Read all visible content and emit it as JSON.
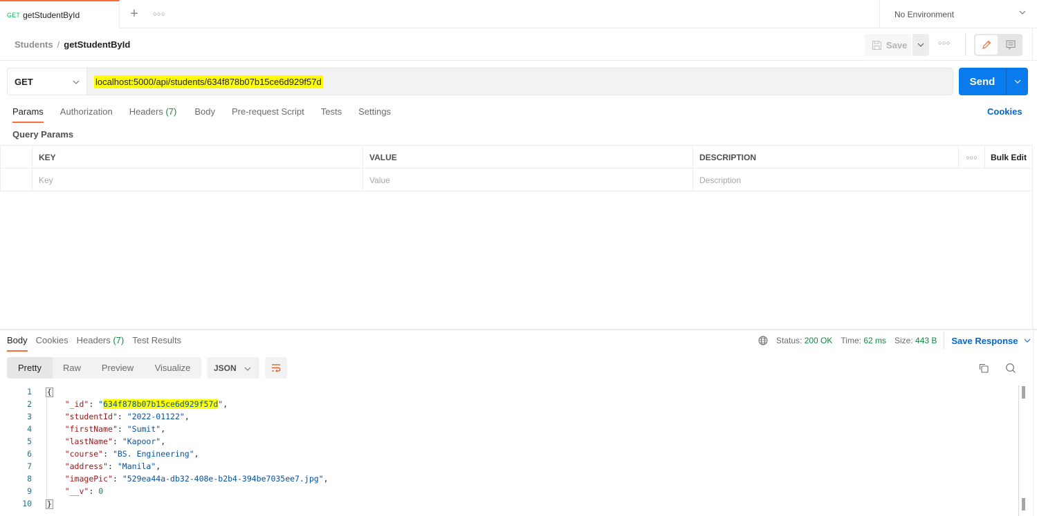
{
  "tab": {
    "method": "GET",
    "name": "getStudentById",
    "active_color": "#ff6c37"
  },
  "environment": {
    "selected": "No Environment"
  },
  "breadcrumb": {
    "parent": "Students",
    "separator": "/",
    "current": "getStudentById"
  },
  "toolbar": {
    "save_label": "Save"
  },
  "request": {
    "method": "GET",
    "url": "localhost:5000/api/students/634f878b07b15ce6d929f57d",
    "send_label": "Send",
    "send_color": "#097bed"
  },
  "request_tabs": [
    {
      "label": "Params",
      "count": "",
      "active": true
    },
    {
      "label": "Authorization",
      "count": "",
      "active": false
    },
    {
      "label": "Headers ",
      "count": "(7)",
      "active": false
    },
    {
      "label": "Body",
      "count": "",
      "active": false
    },
    {
      "label": "Pre-request Script",
      "count": "",
      "active": false
    },
    {
      "label": "Tests",
      "count": "",
      "active": false
    },
    {
      "label": "Settings",
      "count": "",
      "active": false
    }
  ],
  "cookies_link": "Cookies",
  "query_params": {
    "title": "Query Params",
    "headers": [
      "KEY",
      "VALUE",
      "DESCRIPTION"
    ],
    "bulk_edit": "Bulk Edit",
    "placeholders": {
      "key": "Key",
      "value": "Value",
      "description": "Description"
    }
  },
  "response": {
    "tabs": [
      {
        "label": "Body",
        "count": "",
        "active": true
      },
      {
        "label": "Cookies",
        "count": "",
        "active": false
      },
      {
        "label": "Headers ",
        "count": "(7)",
        "active": false
      },
      {
        "label": "Test Results",
        "count": "",
        "active": false
      }
    ],
    "status_label": "Status:",
    "status_value": "200 OK",
    "time_label": "Time:",
    "time_value": "62 ms",
    "size_label": "Size:",
    "size_value": "443 B",
    "save_response": "Save Response",
    "view_modes": [
      "Pretty",
      "Raw",
      "Preview",
      "Visualize"
    ],
    "active_view": "Pretty",
    "format": "JSON",
    "body_lines": [
      {
        "n": "1",
        "parts": [
          {
            "t": "{",
            "c": "brace"
          }
        ]
      },
      {
        "n": "2",
        "parts": [
          {
            "t": "    ",
            "c": "p"
          },
          {
            "t": "\"_id\"",
            "c": "k"
          },
          {
            "t": ": ",
            "c": "p"
          },
          {
            "t": "\"",
            "c": "s"
          },
          {
            "t": "634f878b07b15ce6d929f57d",
            "c": "s hl"
          },
          {
            "t": "\"",
            "c": "s"
          },
          {
            "t": ",",
            "c": "p"
          }
        ]
      },
      {
        "n": "3",
        "parts": [
          {
            "t": "    ",
            "c": "p"
          },
          {
            "t": "\"studentId\"",
            "c": "k"
          },
          {
            "t": ": ",
            "c": "p"
          },
          {
            "t": "\"2022-01122\"",
            "c": "s"
          },
          {
            "t": ",",
            "c": "p"
          }
        ]
      },
      {
        "n": "4",
        "parts": [
          {
            "t": "    ",
            "c": "p"
          },
          {
            "t": "\"firstName\"",
            "c": "k"
          },
          {
            "t": ": ",
            "c": "p"
          },
          {
            "t": "\"Sumit\"",
            "c": "s"
          },
          {
            "t": ",",
            "c": "p"
          }
        ]
      },
      {
        "n": "5",
        "parts": [
          {
            "t": "    ",
            "c": "p"
          },
          {
            "t": "\"lastName\"",
            "c": "k"
          },
          {
            "t": ": ",
            "c": "p"
          },
          {
            "t": "\"Kapoor\"",
            "c": "s"
          },
          {
            "t": ",",
            "c": "p"
          }
        ]
      },
      {
        "n": "6",
        "parts": [
          {
            "t": "    ",
            "c": "p"
          },
          {
            "t": "\"course\"",
            "c": "k"
          },
          {
            "t": ": ",
            "c": "p"
          },
          {
            "t": "\"BS. Engineering\"",
            "c": "s"
          },
          {
            "t": ",",
            "c": "p"
          }
        ]
      },
      {
        "n": "7",
        "parts": [
          {
            "t": "    ",
            "c": "p"
          },
          {
            "t": "\"address\"",
            "c": "k"
          },
          {
            "t": ": ",
            "c": "p"
          },
          {
            "t": "\"Manila\"",
            "c": "s"
          },
          {
            "t": ",",
            "c": "p"
          }
        ]
      },
      {
        "n": "8",
        "parts": [
          {
            "t": "    ",
            "c": "p"
          },
          {
            "t": "\"imagePic\"",
            "c": "k"
          },
          {
            "t": ": ",
            "c": "p"
          },
          {
            "t": "\"529ea44a-db32-408e-b2b4-394be7035ee7.jpg\"",
            "c": "s"
          },
          {
            "t": ",",
            "c": "p"
          }
        ]
      },
      {
        "n": "9",
        "parts": [
          {
            "t": "    ",
            "c": "p"
          },
          {
            "t": "\"__v\"",
            "c": "k"
          },
          {
            "t": ": ",
            "c": "p"
          },
          {
            "t": "0",
            "c": "n"
          }
        ]
      },
      {
        "n": "10",
        "parts": [
          {
            "t": "}",
            "c": "brace"
          }
        ]
      }
    ]
  }
}
